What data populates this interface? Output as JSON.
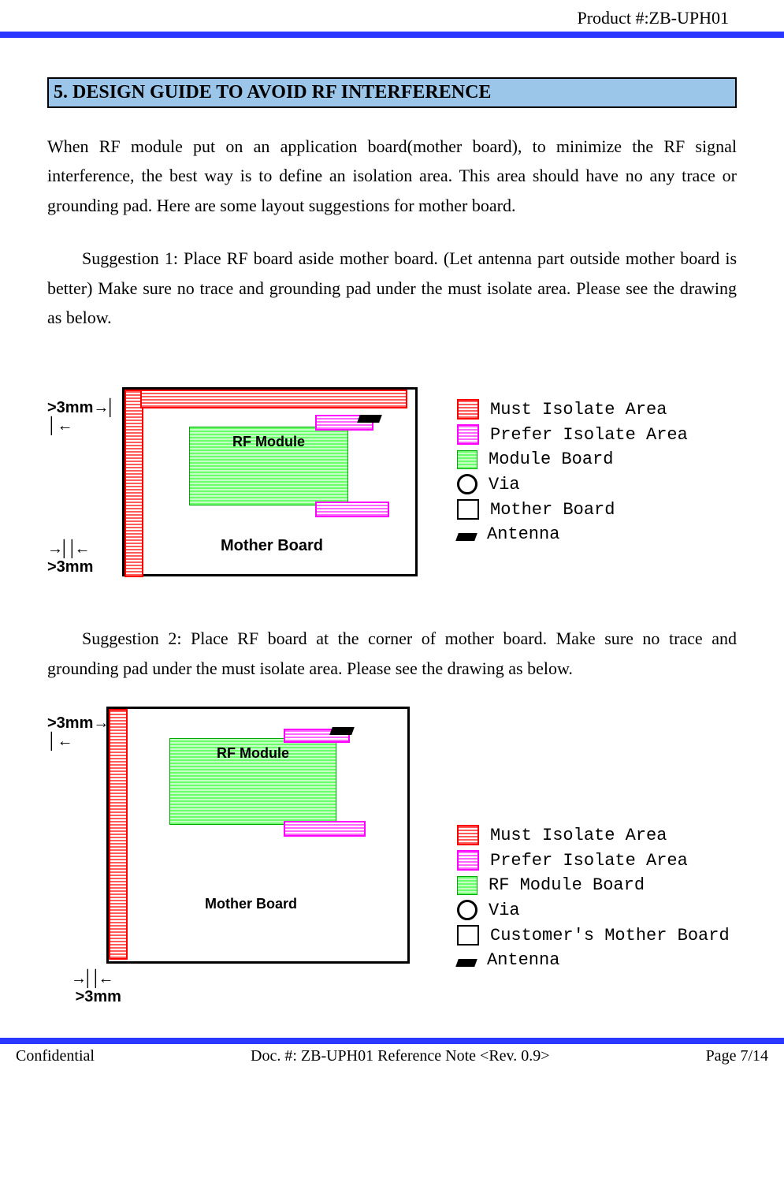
{
  "header": {
    "product": "Product #:ZB-UPH01"
  },
  "section": {
    "title": "5. DESIGN GUIDE TO AVOID RF INTERFERENCE"
  },
  "para1": "When RF module put on an application board(mother board), to minimize the RF signal interference, the best way is to define an isolation area. This area should have no any trace or grounding pad. Here are some layout suggestions for mother board.",
  "para2": "Suggestion 1: Place RF board aside mother board. (Let antenna part outside mother board is better) Make sure no trace and grounding pad under the must isolate area. Please see the drawing as below.",
  "para3": "Suggestion 2: Place RF board at the corner of mother board. Make sure no trace and grounding pad under the must isolate area. Please see the drawing as below.",
  "diagram": {
    "top_marker": ">3mm",
    "bottom_marker": ">3mm",
    "rf_label": "RF Module",
    "mb_label": "Mother Board"
  },
  "legend1": {
    "must": "Must Isolate Area",
    "prefer": "Prefer Isolate Area",
    "module": "Module Board",
    "via": "Via",
    "mother": "Mother Board",
    "antenna": "Antenna"
  },
  "legend2": {
    "must": "Must Isolate Area",
    "prefer": "Prefer Isolate Area",
    "module": "RF Module Board",
    "via": "Via",
    "mother": "Customer's Mother Board",
    "antenna": "Antenna"
  },
  "footer": {
    "left": "Confidential",
    "center": "Doc. #: ZB-UPH01 Reference Note <Rev. 0.9>",
    "right": "Page 7/14"
  }
}
